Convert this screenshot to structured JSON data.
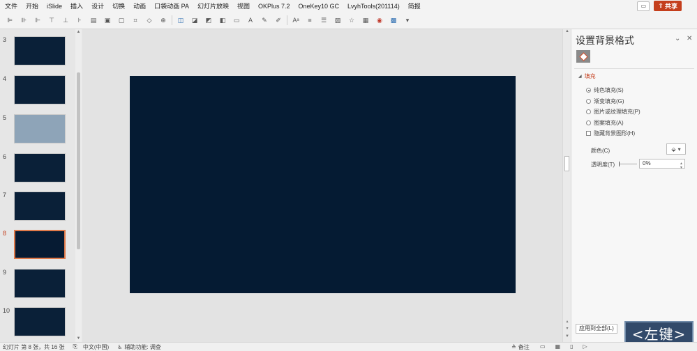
{
  "menu": [
    "文件",
    "开始",
    "iSlide",
    "插入",
    "设计",
    "切换",
    "动画",
    "口袋动画 PA",
    "幻灯片放映",
    "视图",
    "OKPlus 7.2",
    "OneKey10 GC",
    "LvyhTools(201114)",
    "简报"
  ],
  "share_label": "共享",
  "comment_icon": "comment-icon",
  "toolbar_icons": [
    "align-left-icon",
    "align-center-icon",
    "align-right-icon",
    "align-top-icon",
    "align-middle-icon",
    "align-bottom-icon",
    "distribute-icon",
    "group-icon",
    "ungroup-icon",
    "crop-icon",
    "shape-icon",
    "merge-icon",
    "union-icon",
    "intersect-icon",
    "subtract-icon",
    "fill-icon",
    "outline-icon",
    "font-color-icon",
    "highlight-icon",
    "eyedropper-icon",
    "text-icon",
    "line-icon",
    "arrange-icon",
    "picture-icon",
    "star-icon",
    "table-icon",
    "more-icon"
  ],
  "slides": [
    {
      "number": "3",
      "style": "dark"
    },
    {
      "number": "4",
      "style": "dark"
    },
    {
      "number": "5",
      "style": "gray"
    },
    {
      "number": "6",
      "style": "dark"
    },
    {
      "number": "7",
      "style": "dark"
    },
    {
      "number": "8",
      "style": "active"
    },
    {
      "number": "9",
      "style": "dark"
    },
    {
      "number": "10",
      "style": "dark"
    }
  ],
  "slide_background_color": "#051b33",
  "accent_color": "#c43e1c",
  "panel": {
    "title": "设置背景格式",
    "section": "填充",
    "options": [
      {
        "label": "纯色填充(S)",
        "selected": true
      },
      {
        "label": "渐变填充(G)",
        "selected": false
      },
      {
        "label": "图片或纹理填充(P)",
        "selected": false
      },
      {
        "label": "图案填充(A)",
        "selected": false
      }
    ],
    "hide_bg_label": "隐藏背景图形(H)",
    "color_label": "颜色(C)",
    "transparency_label": "透明度(T)",
    "transparency_value": "0%",
    "apply_all_label": "应用到全部(L)"
  },
  "key_hint": "<左键>",
  "status": {
    "slide_info": "幻灯片 第 8 张，共 16 张",
    "language": "中文(中国)",
    "accessibility": "辅助功能: 调查",
    "notes": "备注"
  }
}
